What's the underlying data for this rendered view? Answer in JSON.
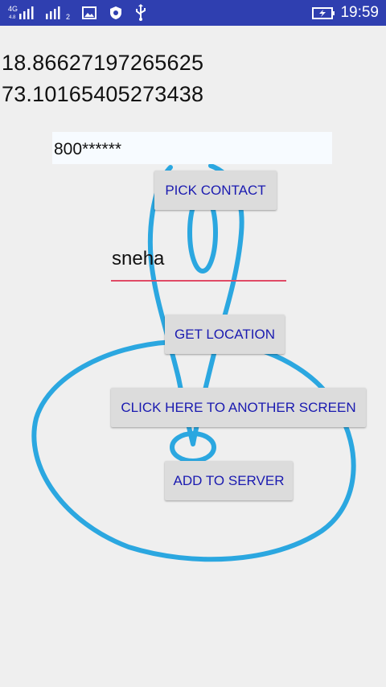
{
  "status_bar": {
    "network_label": "4G",
    "sim1_signal_icon": "signal-bars-icon",
    "sim2_signal_icon": "signal-bars-icon",
    "sim2_index": "2",
    "gallery_icon": "image-icon",
    "shield_icon": "shield-icon",
    "usb_icon": "usb-icon",
    "battery_icon": "battery-charging-icon",
    "time": "19:59"
  },
  "location": {
    "latitude": "18.86627197265625",
    "longitude": "73.10165405273438"
  },
  "form": {
    "phone_value": "800******",
    "pick_contact_label": "PICK CONTACT",
    "name_value": "sneha",
    "get_location_label": "GET LOCATION",
    "another_screen_label": "CLICK HERE TO ANOTHER SCREEN",
    "add_to_server_label": "ADD TO SERVER"
  },
  "colors": {
    "status_bar": "#2f3fb0",
    "background": "#efefef",
    "button_bg": "#dcdcdc",
    "button_text": "#1a1ab0",
    "input_underline": "#e04a66",
    "pin_stroke": "#2ba7e0"
  },
  "background_art": "map-pin-icon"
}
